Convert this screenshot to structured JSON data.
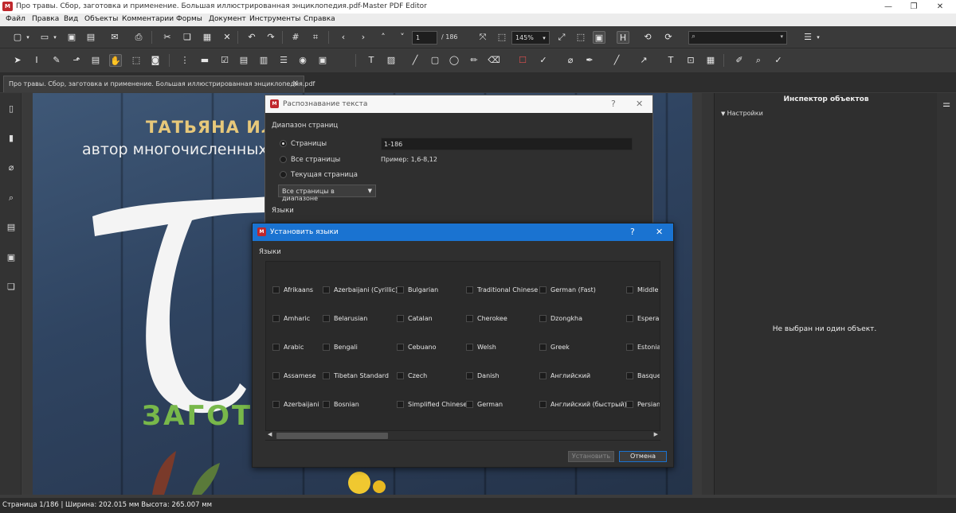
{
  "window": {
    "title": "Про травы. Сбор, заготовка и применение. Большая иллюстрированная энциклопедия.pdf-Master PDF Editor",
    "logo": "M"
  },
  "menu": [
    "Файл",
    "Правка",
    "Вид",
    "Объекты",
    "Комментарии",
    "Формы",
    "Документ",
    "Инструменты",
    "Справка"
  ],
  "toolbar": {
    "page_current": "1",
    "page_total": "/ 186",
    "zoom": "145%"
  },
  "tab": {
    "label": "Про травы. Сбор, заготовка и применение. Большая иллюстрированная энциклопедия.pdf",
    "close": "✕"
  },
  "cover": {
    "author": "ТАТЬЯНА ИЛЬ",
    "subtitle": "автор многочисленных",
    "green_text": "ЗАГОТО"
  },
  "inspector": {
    "title": "Инспектор объектов",
    "section": "Настройки",
    "empty": "Не выбран ни один объект."
  },
  "status": "Страница 1/186 | Ширина: 202.015 мм Высота: 265.007 мм",
  "ocr_dialog": {
    "title": "Распознавание текста",
    "help": "?",
    "close": "✕",
    "range_label": "Диапазон страниц",
    "opt_pages": "Страницы",
    "opt_all": "Все страницы",
    "opt_current": "Текущая страница",
    "range_value": "1-186",
    "example": "Пример: 1,6-8,12",
    "scope": "Все страницы в диапазоне",
    "languages_label": "Языки"
  },
  "lang_dialog": {
    "title": "Установить языки",
    "help": "?",
    "close": "✕",
    "languages_label": "Языки",
    "columns": [
      [
        "Afrikaans",
        "Amharic",
        "Arabic",
        "Assamese",
        "Azerbaijani"
      ],
      [
        "Azerbaijani (Cyrillic)",
        "Belarusian",
        "Bengali",
        "Tibetan Standard",
        "Bosnian"
      ],
      [
        "Bulgarian",
        "Catalan",
        "Cebuano",
        "Czech",
        "Simplified Chinese"
      ],
      [
        "Traditional Chinese",
        "Cherokee",
        "Welsh",
        "Danish",
        "German"
      ],
      [
        "German (Fast)",
        "Dzongkha",
        "Greek",
        "Английский",
        "Английский (быстрый)"
      ],
      [
        "Middle E",
        "Esperar",
        "Estoniar",
        "Basque",
        "Persian"
      ]
    ],
    "install_button": "Установить",
    "cancel_button": "Отмена"
  },
  "colors": {
    "accent": "#1a73d1",
    "logo_red": "#c0282d",
    "cover_gold": "#e7c87a",
    "cover_green": "#78b84a"
  }
}
